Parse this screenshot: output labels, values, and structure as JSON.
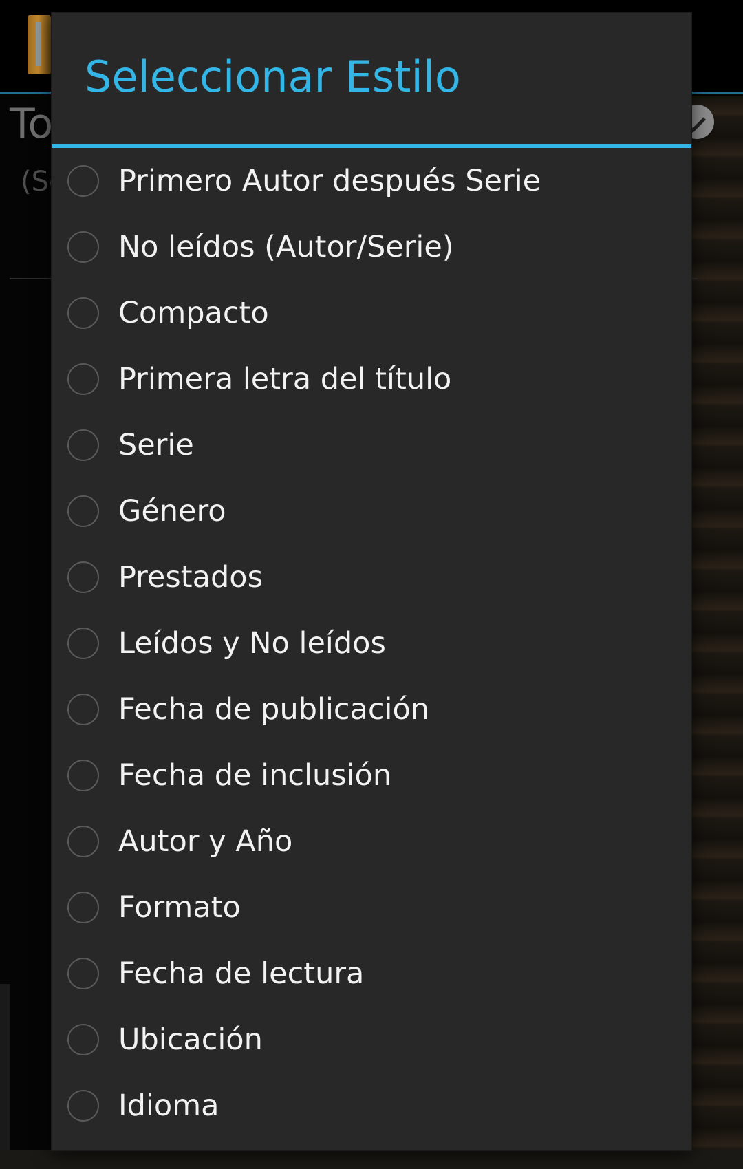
{
  "background": {
    "title_partial": "To",
    "subtitle_partial": "(Se"
  },
  "dialog": {
    "title": "Seleccionar Estilo",
    "options": [
      {
        "label": "Primero Autor después Serie",
        "selected": false
      },
      {
        "label": "No leídos (Autor/Serie)",
        "selected": false
      },
      {
        "label": "Compacto",
        "selected": false
      },
      {
        "label": "Primera letra del título",
        "selected": false
      },
      {
        "label": "Serie",
        "selected": false
      },
      {
        "label": "Género",
        "selected": false
      },
      {
        "label": "Prestados",
        "selected": false
      },
      {
        "label": "Leídos y No leídos",
        "selected": false
      },
      {
        "label": "Fecha de publicación",
        "selected": false
      },
      {
        "label": "Fecha de inclusión",
        "selected": false
      },
      {
        "label": "Autor y Año",
        "selected": false
      },
      {
        "label": "Formato",
        "selected": false
      },
      {
        "label": "Fecha de lectura",
        "selected": false
      },
      {
        "label": "Ubicación",
        "selected": false
      },
      {
        "label": "Idioma",
        "selected": false
      }
    ]
  },
  "colors": {
    "accent": "#33b5e5",
    "dialog_bg": "#282828",
    "text": "#f2f2f2"
  },
  "icons": {
    "app": "book-app-icon",
    "confirm": "checkmark-icon",
    "radio": "radio-unchecked-icon"
  }
}
